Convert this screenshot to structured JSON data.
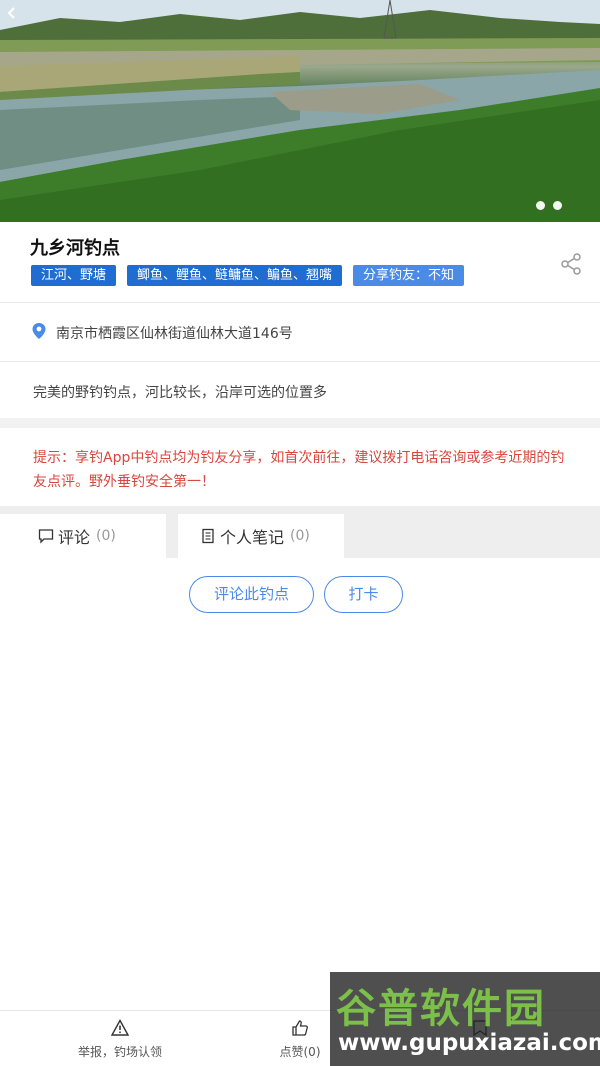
{
  "header": {
    "back_icon": "chevron-left-icon"
  },
  "carousel": {
    "dot_count": 2
  },
  "spot": {
    "title": "九乡河钓点",
    "tags": [
      "江河、野塘",
      "鲫鱼、鲤鱼、鲢鳙鱼、鳊鱼、翘嘴",
      "分享钓友：不知"
    ],
    "share_icon": "share-icon"
  },
  "address": {
    "text": "南京市栖霞区仙林街道仙林大道146号",
    "icon": "location-pin-icon"
  },
  "description": {
    "text": "完美的野钓钓点，河比较长，沿岸可选的位置多"
  },
  "notice": {
    "text": "提示：享钓App中钓点均为钓友分享，如首次前往，建议拨打电话咨询或参考近期的钓友点评。野外垂钓安全第一！"
  },
  "tabs": [
    {
      "label": "评论",
      "count": "(0)",
      "icon": "comment-icon"
    },
    {
      "label": "个人笔记",
      "count": "(0)",
      "icon": "notebook-icon"
    }
  ],
  "actions": {
    "comment_label": "评论此钓点",
    "checkin_label": "打卡"
  },
  "bottom_bar": {
    "report_label": "举报，钓场认领",
    "like_label": "点赞(0)"
  },
  "watermark": {
    "cn": "谷普软件园",
    "url": "www.gupuxiazai.com"
  },
  "colors": {
    "accent": "#4a8be8",
    "tag_dark": "#1f6dd0",
    "notice_red": "#d9463e"
  }
}
